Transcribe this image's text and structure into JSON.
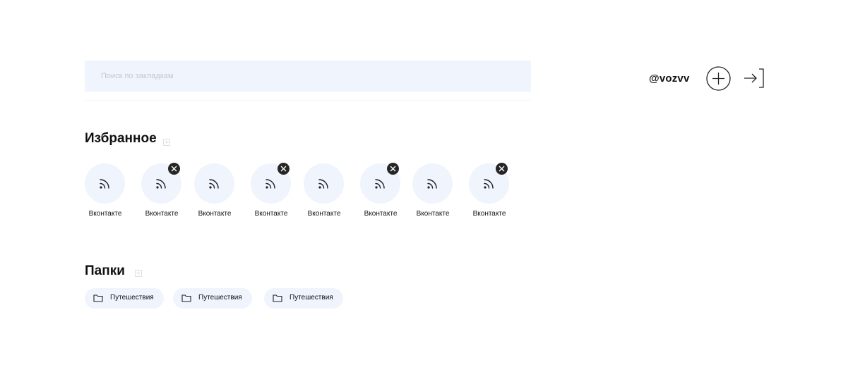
{
  "search": {
    "placeholder": "Поиск по закладкам",
    "value": ""
  },
  "header": {
    "username": "@vozvv"
  },
  "favorites": {
    "title": "Избранное",
    "items": [
      {
        "label": "Вконтакте",
        "removable": false,
        "icon": "rss-icon"
      },
      {
        "label": "Вконтакте",
        "removable": true,
        "icon": "rss-icon"
      },
      {
        "label": "Вконтакте",
        "removable": false,
        "icon": "rss-icon"
      },
      {
        "label": "Вконтакте",
        "removable": true,
        "icon": "rss-icon"
      },
      {
        "label": "Вконтакте",
        "removable": false,
        "icon": "rss-icon"
      },
      {
        "label": "Вконтакте",
        "removable": true,
        "icon": "rss-icon"
      },
      {
        "label": "Вконтакте",
        "removable": false,
        "icon": "rss-icon"
      },
      {
        "label": "Вконтакте",
        "removable": true,
        "icon": "rss-icon"
      }
    ]
  },
  "folders": {
    "title": "Папки",
    "items": [
      {
        "label": "Путешествия",
        "icon": "folder-icon"
      },
      {
        "label": "Путешествия",
        "icon": "folder-icon"
      },
      {
        "label": "Путешествия",
        "icon": "folder-icon"
      }
    ]
  },
  "colors": {
    "accent_bg": "#eff4fd",
    "text": "#111111",
    "badge": "#262626",
    "placeholder": "#c2c8d3"
  }
}
